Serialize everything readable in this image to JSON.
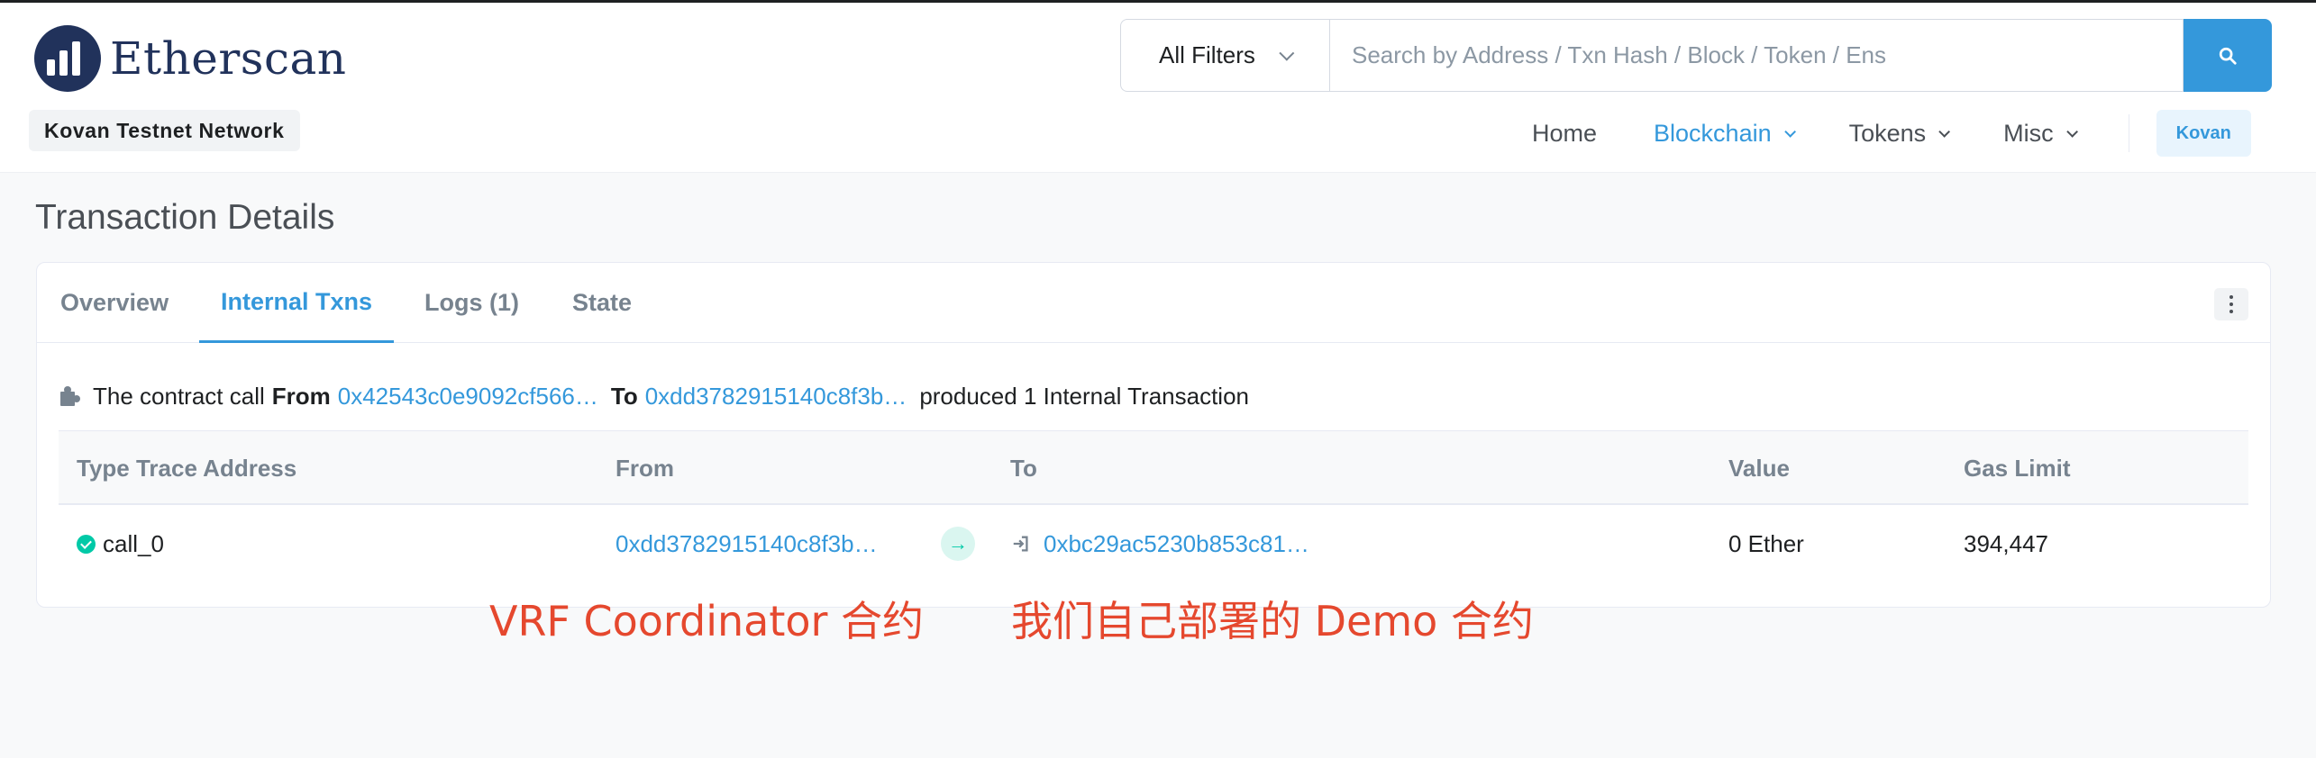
{
  "brand": {
    "name": "Etherscan",
    "network": "Kovan Testnet Network",
    "colors": {
      "navy": "#21325b",
      "accent": "#3498db",
      "success": "#00c9a7",
      "annotation": "#e5482e"
    }
  },
  "search": {
    "filter_label": "All Filters",
    "placeholder": "Search by Address / Txn Hash / Block / Token / Ens",
    "button_icon": "search-icon"
  },
  "nav": {
    "items": [
      {
        "label": "Home",
        "active": false,
        "dropdown": false
      },
      {
        "label": "Blockchain",
        "active": true,
        "dropdown": true
      },
      {
        "label": "Tokens",
        "active": false,
        "dropdown": true
      },
      {
        "label": "Misc",
        "active": false,
        "dropdown": true
      }
    ],
    "network_button": "Kovan"
  },
  "page": {
    "title": "Transaction Details",
    "tabs": [
      {
        "label": "Overview",
        "active": false
      },
      {
        "label": "Internal Txns",
        "active": true
      },
      {
        "label": "Logs (1)",
        "active": false
      },
      {
        "label": "State",
        "active": false
      }
    ],
    "summary": {
      "prefix": "The contract call",
      "from_label": "From",
      "from_address": "0x42543c0e9092cf566…",
      "to_label": "To",
      "to_address": "0xdd3782915140c8f3b…",
      "suffix": "produced 1 Internal Transaction"
    },
    "table": {
      "headers": [
        "Type Trace Address",
        "From",
        "To",
        "Value",
        "Gas Limit"
      ],
      "rows": [
        {
          "type": "call_0",
          "from": "0xdd3782915140c8f3b…",
          "to": "0xbc29ac5230b853c81…",
          "value": "0 Ether",
          "gas_limit": "394,447"
        }
      ]
    }
  },
  "annotations": {
    "from_note": "VRF Coordinator 合约",
    "to_note": "我们自己部署的 Demo 合约"
  }
}
